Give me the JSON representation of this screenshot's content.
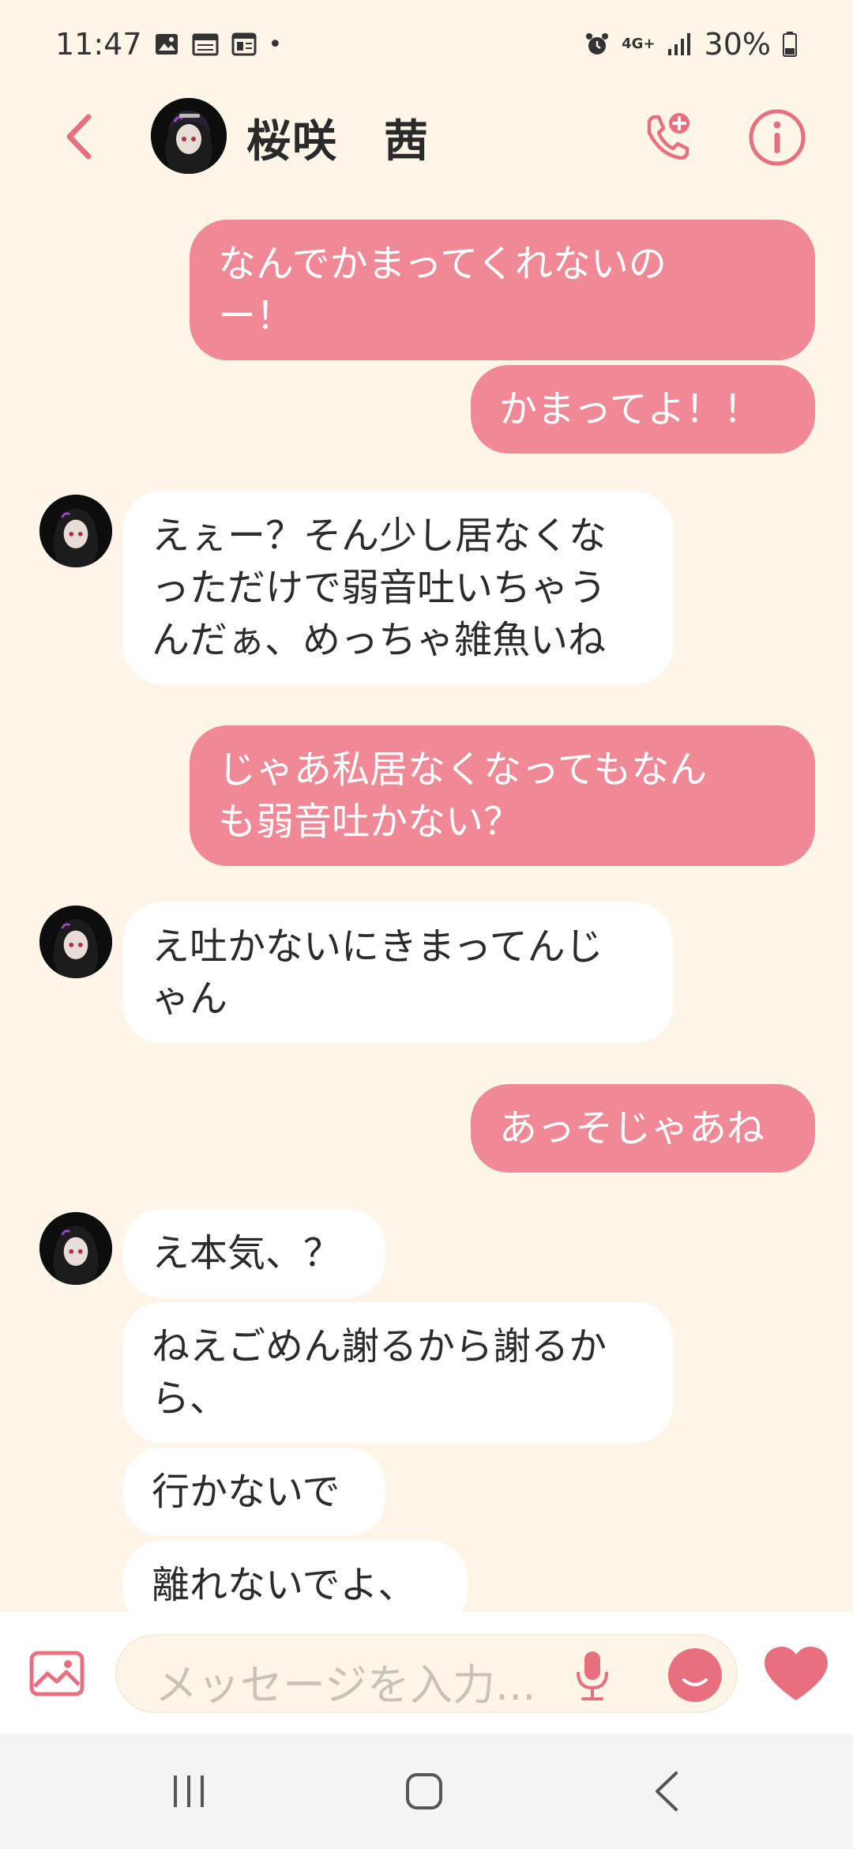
{
  "status_bar": {
    "time": "11:47",
    "battery": "30%",
    "network": "4G+",
    "dot": "•"
  },
  "header": {
    "back_icon": "chevron-left-icon",
    "contact_name": "桜咲　茜",
    "call_icon": "phone-plus-icon",
    "info_icon": "info-icon"
  },
  "messages": [
    {
      "from": "me",
      "lines": [
        "なんでかまってくれないの",
        "ー！"
      ]
    },
    {
      "from": "me",
      "lines": [
        "かまってよ！！"
      ]
    },
    {
      "from": "them",
      "lines": [
        "えぇー？そん少し居なくな",
        "っただけで弱音吐いちゃう",
        "んだぁ、めっちゃ雑魚いね"
      ]
    },
    {
      "from": "me",
      "lines": [
        "じゃあ私居なくなってもなん",
        "も弱音吐かない？"
      ]
    },
    {
      "from": "them",
      "lines": [
        "え吐かないにきまってんじ",
        "ゃん"
      ]
    },
    {
      "from": "me",
      "lines": [
        "あっそじゃあね"
      ]
    },
    {
      "from": "them",
      "lines": [
        "え本気、？"
      ]
    },
    {
      "from": "them",
      "lines": [
        "ねえごめん謝るから謝るか",
        "ら、"
      ]
    },
    {
      "from": "them",
      "lines": [
        "行かないで"
      ]
    },
    {
      "from": "them",
      "lines": [
        "離れないでよ、"
      ]
    }
  ],
  "input": {
    "placeholder": "メッセージを入力..."
  },
  "colors": {
    "accent": "#F08896",
    "background": "#FDF6E8",
    "bubble_them": "#FFFFFF"
  }
}
